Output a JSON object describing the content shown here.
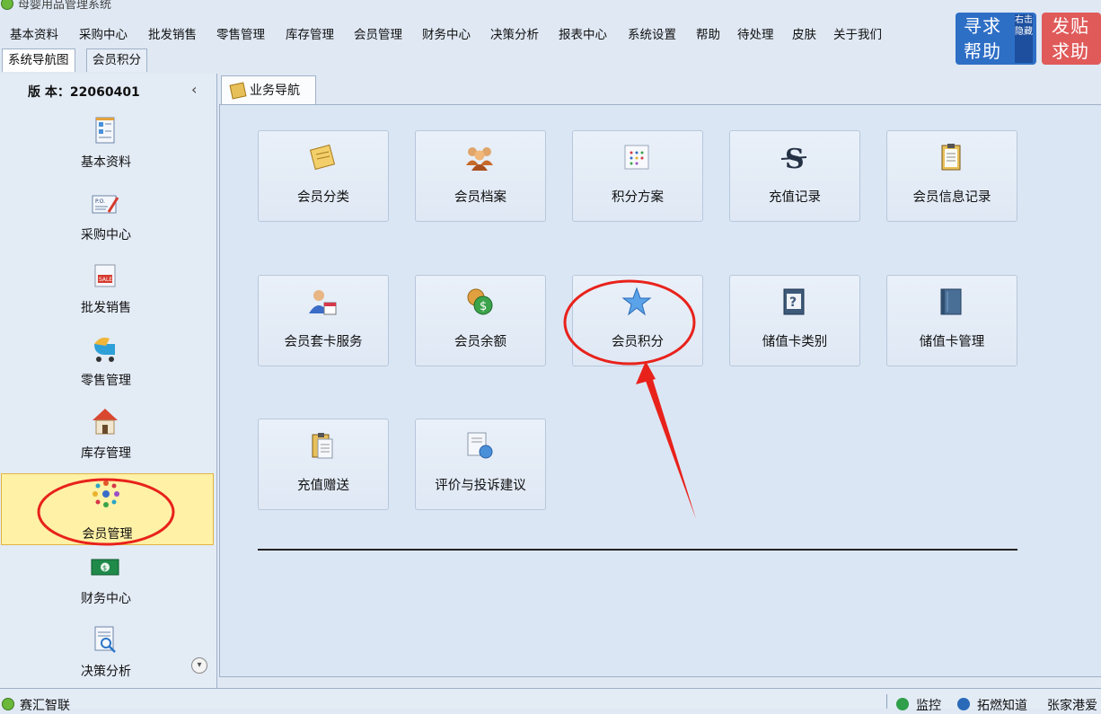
{
  "window": {
    "title": "母婴用品管理系统"
  },
  "menu": [
    "基本资料",
    "采购中心",
    "批发销售",
    "零售管理",
    "库存管理",
    "会员管理",
    "财务中心",
    "决策分析",
    "报表中心",
    "系统设置",
    "帮助",
    "待处理",
    "皮肤",
    "关于我们"
  ],
  "help": {
    "seek_line1": "寻求",
    "seek_line2": "帮助",
    "hide_text": "右击隐藏",
    "post_line1": "发贴",
    "post_line2": "求助"
  },
  "top_tabs": [
    "系统导航图",
    "会员积分"
  ],
  "sidebar": {
    "version": "版 本：22060401",
    "collapse_glyph": "‹",
    "items": [
      {
        "label": "基本资料",
        "icon": "document-form-icon"
      },
      {
        "label": "采购中心",
        "icon": "purchase-order-icon"
      },
      {
        "label": "批发销售",
        "icon": "sale-tag-icon"
      },
      {
        "label": "零售管理",
        "icon": "stroller-icon"
      },
      {
        "label": "库存管理",
        "icon": "house-icon"
      },
      {
        "label": "会员管理",
        "icon": "members-circle-icon"
      },
      {
        "label": "财务中心",
        "icon": "cash-icon"
      },
      {
        "label": "决策分析",
        "icon": "report-magnifier-icon"
      }
    ],
    "scroll_glyph": "▾"
  },
  "content": {
    "tab_label": "业务导航",
    "tiles": [
      {
        "label": "会员分类",
        "icon": "note-pad-icon"
      },
      {
        "label": "会员档案",
        "icon": "people-group-icon"
      },
      {
        "label": "积分方案",
        "icon": "dotted-grid-icon"
      },
      {
        "label": "充值记录",
        "icon": "dollar-s-icon"
      },
      {
        "label": "会员信息记录",
        "icon": "clipboard-icon"
      },
      {
        "label": "会员套卡服务",
        "icon": "user-calendar-icon"
      },
      {
        "label": "会员余额",
        "icon": "coins-icon"
      },
      {
        "label": "会员积分",
        "icon": "star-icon"
      },
      {
        "label": "储值卡类别",
        "icon": "help-book-icon"
      },
      {
        "label": "储值卡管理",
        "icon": "book-icon"
      },
      {
        "label": "充值赠送",
        "icon": "clipboard-doc-icon"
      },
      {
        "label": "评价与投诉建议",
        "icon": "document-person-icon"
      }
    ]
  },
  "status": {
    "left": "赛汇智联",
    "right_1": "监控",
    "right_2": "拓燃知道",
    "right_3": "张家港爱"
  },
  "colors": {
    "accent_blue": "#2e6fc6",
    "accent_red": "#e05a5a",
    "active_sidebar": "#fff1a6",
    "annotation_red": "#e8221b"
  }
}
